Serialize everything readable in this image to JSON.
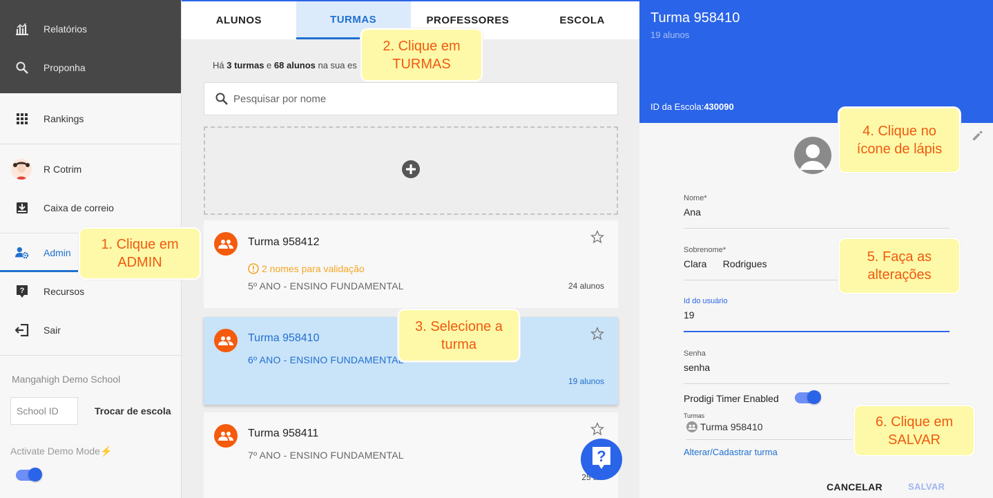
{
  "sidebar": {
    "top_items": [
      {
        "label": "Relatórios",
        "icon": "chart-icon"
      },
      {
        "label": "Proponha",
        "icon": "search-icon"
      }
    ],
    "rankings": "Rankings",
    "user_name": "R Cotrim",
    "mailbox": "Caixa de correio",
    "admin": "Admin",
    "resources": "Recursos",
    "logout": "Sair",
    "school_name": "Mangahigh Demo School",
    "school_id_placeholder": "School ID",
    "change_school": "Trocar de escola",
    "demo_mode": "Activate Demo Mode",
    "demo_mode_enabled": true
  },
  "tabs": [
    {
      "label": "ALUNOS",
      "active": false
    },
    {
      "label": "TURMAS",
      "active": true
    },
    {
      "label": "PROFESSORES",
      "active": false
    },
    {
      "label": "ESCOLA",
      "active": false
    }
  ],
  "summary": {
    "prefix": "Há ",
    "classes": "3 turmas",
    "mid": " e ",
    "students": "68 alunos",
    "suffix": " na sua es"
  },
  "search": {
    "placeholder": "Pesquisar por nome"
  },
  "classes": [
    {
      "name": "Turma 958412",
      "warning": "2 nomes para validação",
      "grade": "5º ANO - ENSINO FUNDAMENTAL",
      "count": "24 alunos",
      "selected": false
    },
    {
      "name": "Turma 958410",
      "warning": "",
      "grade": "6º ANO - ENSINO FUNDAMENTAL",
      "count": "19 alunos",
      "selected": true
    },
    {
      "name": "Turma 958411",
      "warning": "",
      "grade": "7º ANO - ENSINO FUNDAMENTAL",
      "count": "25 alu",
      "selected": false
    }
  ],
  "panel": {
    "title": "Turma 958410",
    "subtitle": "19 alunos",
    "school_id_label": "ID da Escola:",
    "school_id": "430090",
    "fields": {
      "nome_label": "Nome*",
      "nome_value": "Ana",
      "sobrenome_label": "Sobrenome*",
      "sobrenome_value": "Clara      Rodrigues",
      "id_label": "Id do usuário",
      "id_value": "19",
      "senha_label": "Senha",
      "senha_value": "senha"
    },
    "timer_label": "Prodigi Timer Enabled",
    "timer_enabled": true,
    "turmas_label": "Turmas",
    "turmas_value": "Turma 958410",
    "change_class_link": "Alterar/Cadastrar turma",
    "cancel": "CANCELAR",
    "save": "SALVAR"
  },
  "callouts": {
    "c1": "1. Clique em\nADMIN",
    "c2": "2. Clique em\nTURMAS",
    "c3": "3. Selecione a\nturma",
    "c4": "4. Clique no\nícone de lápis",
    "c5": "5. Faça as\nalterações",
    "c6": "6. Clique em\nSALVAR"
  },
  "colors": {
    "accent": "#2a64e8",
    "class_icon": "#f45b0c",
    "callout_bg": "#fdf9a8",
    "callout_text": "#f05a10"
  }
}
